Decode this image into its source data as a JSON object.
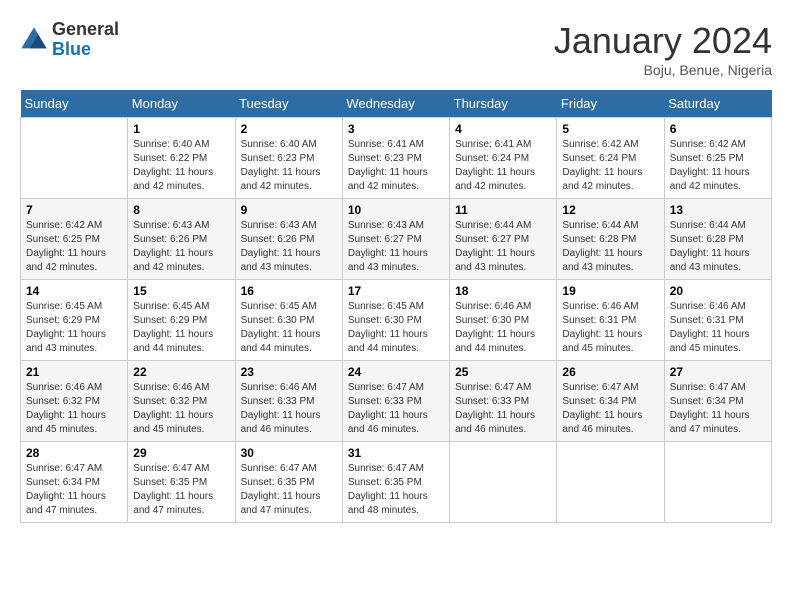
{
  "logo": {
    "general": "General",
    "blue": "Blue"
  },
  "header": {
    "month": "January 2024",
    "location": "Boju, Benue, Nigeria"
  },
  "days_of_week": [
    "Sunday",
    "Monday",
    "Tuesday",
    "Wednesday",
    "Thursday",
    "Friday",
    "Saturday"
  ],
  "weeks": [
    [
      {
        "day": "",
        "sunrise": "",
        "sunset": "",
        "daylight": ""
      },
      {
        "day": "1",
        "sunrise": "Sunrise: 6:40 AM",
        "sunset": "Sunset: 6:22 PM",
        "daylight": "Daylight: 11 hours and 42 minutes."
      },
      {
        "day": "2",
        "sunrise": "Sunrise: 6:40 AM",
        "sunset": "Sunset: 6:23 PM",
        "daylight": "Daylight: 11 hours and 42 minutes."
      },
      {
        "day": "3",
        "sunrise": "Sunrise: 6:41 AM",
        "sunset": "Sunset: 6:23 PM",
        "daylight": "Daylight: 11 hours and 42 minutes."
      },
      {
        "day": "4",
        "sunrise": "Sunrise: 6:41 AM",
        "sunset": "Sunset: 6:24 PM",
        "daylight": "Daylight: 11 hours and 42 minutes."
      },
      {
        "day": "5",
        "sunrise": "Sunrise: 6:42 AM",
        "sunset": "Sunset: 6:24 PM",
        "daylight": "Daylight: 11 hours and 42 minutes."
      },
      {
        "day": "6",
        "sunrise": "Sunrise: 6:42 AM",
        "sunset": "Sunset: 6:25 PM",
        "daylight": "Daylight: 11 hours and 42 minutes."
      }
    ],
    [
      {
        "day": "7",
        "sunrise": "Sunrise: 6:42 AM",
        "sunset": "Sunset: 6:25 PM",
        "daylight": "Daylight: 11 hours and 42 minutes."
      },
      {
        "day": "8",
        "sunrise": "Sunrise: 6:43 AM",
        "sunset": "Sunset: 6:26 PM",
        "daylight": "Daylight: 11 hours and 42 minutes."
      },
      {
        "day": "9",
        "sunrise": "Sunrise: 6:43 AM",
        "sunset": "Sunset: 6:26 PM",
        "daylight": "Daylight: 11 hours and 43 minutes."
      },
      {
        "day": "10",
        "sunrise": "Sunrise: 6:43 AM",
        "sunset": "Sunset: 6:27 PM",
        "daylight": "Daylight: 11 hours and 43 minutes."
      },
      {
        "day": "11",
        "sunrise": "Sunrise: 6:44 AM",
        "sunset": "Sunset: 6:27 PM",
        "daylight": "Daylight: 11 hours and 43 minutes."
      },
      {
        "day": "12",
        "sunrise": "Sunrise: 6:44 AM",
        "sunset": "Sunset: 6:28 PM",
        "daylight": "Daylight: 11 hours and 43 minutes."
      },
      {
        "day": "13",
        "sunrise": "Sunrise: 6:44 AM",
        "sunset": "Sunset: 6:28 PM",
        "daylight": "Daylight: 11 hours and 43 minutes."
      }
    ],
    [
      {
        "day": "14",
        "sunrise": "Sunrise: 6:45 AM",
        "sunset": "Sunset: 6:29 PM",
        "daylight": "Daylight: 11 hours and 43 minutes."
      },
      {
        "day": "15",
        "sunrise": "Sunrise: 6:45 AM",
        "sunset": "Sunset: 6:29 PM",
        "daylight": "Daylight: 11 hours and 44 minutes."
      },
      {
        "day": "16",
        "sunrise": "Sunrise: 6:45 AM",
        "sunset": "Sunset: 6:30 PM",
        "daylight": "Daylight: 11 hours and 44 minutes."
      },
      {
        "day": "17",
        "sunrise": "Sunrise: 6:45 AM",
        "sunset": "Sunset: 6:30 PM",
        "daylight": "Daylight: 11 hours and 44 minutes."
      },
      {
        "day": "18",
        "sunrise": "Sunrise: 6:46 AM",
        "sunset": "Sunset: 6:30 PM",
        "daylight": "Daylight: 11 hours and 44 minutes."
      },
      {
        "day": "19",
        "sunrise": "Sunrise: 6:46 AM",
        "sunset": "Sunset: 6:31 PM",
        "daylight": "Daylight: 11 hours and 45 minutes."
      },
      {
        "day": "20",
        "sunrise": "Sunrise: 6:46 AM",
        "sunset": "Sunset: 6:31 PM",
        "daylight": "Daylight: 11 hours and 45 minutes."
      }
    ],
    [
      {
        "day": "21",
        "sunrise": "Sunrise: 6:46 AM",
        "sunset": "Sunset: 6:32 PM",
        "daylight": "Daylight: 11 hours and 45 minutes."
      },
      {
        "day": "22",
        "sunrise": "Sunrise: 6:46 AM",
        "sunset": "Sunset: 6:32 PM",
        "daylight": "Daylight: 11 hours and 45 minutes."
      },
      {
        "day": "23",
        "sunrise": "Sunrise: 6:46 AM",
        "sunset": "Sunset: 6:33 PM",
        "daylight": "Daylight: 11 hours and 46 minutes."
      },
      {
        "day": "24",
        "sunrise": "Sunrise: 6:47 AM",
        "sunset": "Sunset: 6:33 PM",
        "daylight": "Daylight: 11 hours and 46 minutes."
      },
      {
        "day": "25",
        "sunrise": "Sunrise: 6:47 AM",
        "sunset": "Sunset: 6:33 PM",
        "daylight": "Daylight: 11 hours and 46 minutes."
      },
      {
        "day": "26",
        "sunrise": "Sunrise: 6:47 AM",
        "sunset": "Sunset: 6:34 PM",
        "daylight": "Daylight: 11 hours and 46 minutes."
      },
      {
        "day": "27",
        "sunrise": "Sunrise: 6:47 AM",
        "sunset": "Sunset: 6:34 PM",
        "daylight": "Daylight: 11 hours and 47 minutes."
      }
    ],
    [
      {
        "day": "28",
        "sunrise": "Sunrise: 6:47 AM",
        "sunset": "Sunset: 6:34 PM",
        "daylight": "Daylight: 11 hours and 47 minutes."
      },
      {
        "day": "29",
        "sunrise": "Sunrise: 6:47 AM",
        "sunset": "Sunset: 6:35 PM",
        "daylight": "Daylight: 11 hours and 47 minutes."
      },
      {
        "day": "30",
        "sunrise": "Sunrise: 6:47 AM",
        "sunset": "Sunset: 6:35 PM",
        "daylight": "Daylight: 11 hours and 47 minutes."
      },
      {
        "day": "31",
        "sunrise": "Sunrise: 6:47 AM",
        "sunset": "Sunset: 6:35 PM",
        "daylight": "Daylight: 11 hours and 48 minutes."
      },
      {
        "day": "",
        "sunrise": "",
        "sunset": "",
        "daylight": ""
      },
      {
        "day": "",
        "sunrise": "",
        "sunset": "",
        "daylight": ""
      },
      {
        "day": "",
        "sunrise": "",
        "sunset": "",
        "daylight": ""
      }
    ]
  ]
}
